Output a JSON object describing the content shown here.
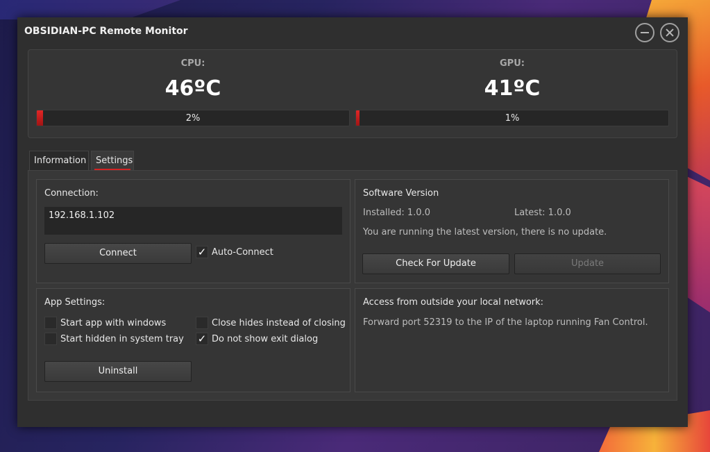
{
  "window": {
    "title": "OBSIDIAN-PC Remote Monitor"
  },
  "stats": {
    "cpu": {
      "label": "CPU:",
      "temp": "46ºC",
      "usage_text": "2%",
      "usage": 0.02
    },
    "gpu": {
      "label": "GPU:",
      "temp": "41ºC",
      "usage_text": "1%",
      "usage": 0.01
    },
    "bar_color": "#d32424"
  },
  "tabs": [
    {
      "label": "Information",
      "active": false
    },
    {
      "label": "Settings",
      "active": true
    }
  ],
  "connection": {
    "title": "Connection:",
    "ip_value": "192.168.1.102",
    "connect_label": "Connect",
    "auto_connect_label": "Auto-Connect",
    "auto_connect_checked": true
  },
  "software_version": {
    "title": "Software Version",
    "installed": "Installed: 1.0.0",
    "latest": "Latest: 1.0.0",
    "status": "You are running the latest version, there is no update.",
    "check_label": "Check For Update",
    "update_label": "Update"
  },
  "app_settings": {
    "title": "App Settings:",
    "options": [
      {
        "label": "Start app with windows",
        "checked": false
      },
      {
        "label": "Close hides instead of closing",
        "checked": false
      },
      {
        "label": "Start hidden in system tray",
        "checked": false
      },
      {
        "label": "Do not show exit dialog",
        "checked": true
      }
    ],
    "uninstall_label": "Uninstall"
  },
  "network": {
    "title": "Access from outside your local network:",
    "text": "Forward port 52319 to the IP of the laptop running Fan Control."
  },
  "icons": {
    "minimize": "minimize-icon",
    "close": "close-icon",
    "checkmark": "✓"
  }
}
